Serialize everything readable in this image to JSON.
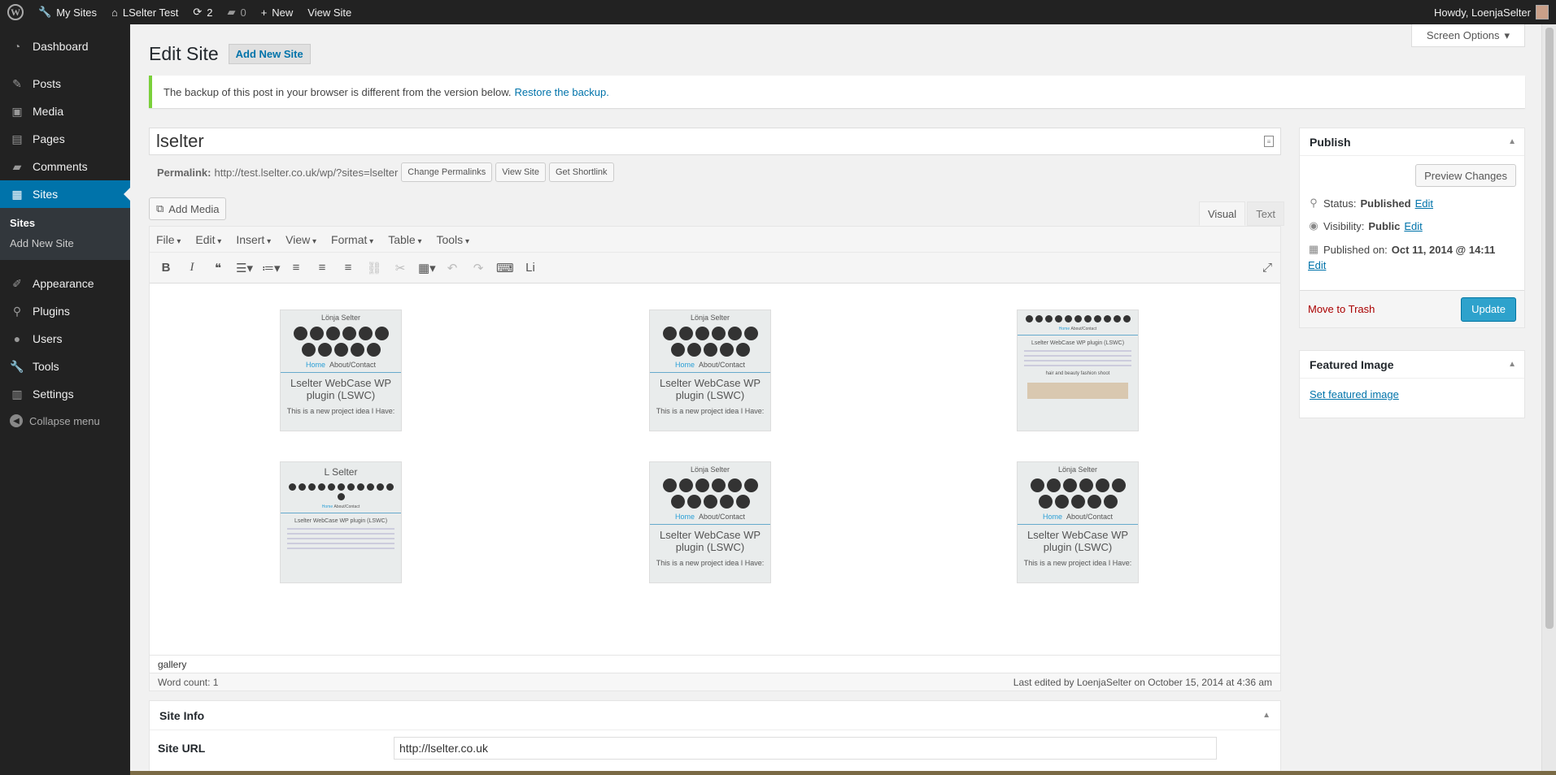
{
  "adminbar": {
    "my_sites": "My Sites",
    "site_name": "LSelter Test",
    "updates_count": "2",
    "comments_count": "0",
    "new_label": "New",
    "view_site": "View Site",
    "howdy": "Howdy, LoenjaSelter"
  },
  "sidebar": {
    "dashboard": "Dashboard",
    "posts": "Posts",
    "media": "Media",
    "pages": "Pages",
    "comments": "Comments",
    "sites": "Sites",
    "sub_sites": "Sites",
    "sub_add_new": "Add New Site",
    "appearance": "Appearance",
    "plugins": "Plugins",
    "users": "Users",
    "tools": "Tools",
    "settings": "Settings",
    "collapse": "Collapse menu"
  },
  "screen_options": "Screen Options",
  "page": {
    "title": "Edit Site",
    "add_new": "Add New Site"
  },
  "notice": {
    "text": "The backup of this post in your browser is different from the version below.",
    "link": "Restore the backup."
  },
  "post": {
    "title": "lselter",
    "permalink_label": "Permalink:",
    "permalink_url": "http://test.lselter.co.uk/wp/?sites=lselter",
    "change_permalinks": "Change Permalinks",
    "view_site": "View Site",
    "get_shortlink": "Get Shortlink"
  },
  "editor": {
    "add_media": "Add Media",
    "tab_visual": "Visual",
    "tab_text": "Text",
    "menus": [
      "File",
      "Edit",
      "Insert",
      "View",
      "Format",
      "Table",
      "Tools"
    ],
    "path": "gallery",
    "word_count": "Word count: 1",
    "last_edited": "Last edited by LoenjaSelter on October 15, 2014 at 4:36 am"
  },
  "thumbnails": {
    "top_name": "Lönja Selter",
    "nav_home": "Home",
    "nav_about": "About/Contact",
    "title": "Lselter WebCase WP plugin (LSWC)",
    "text": "This is a new project idea I Have:",
    "alt_heading": "L Selter",
    "small_title": "Lselter WebCase WP plugin (LSWC)",
    "fashion_caption": "hair and beauty fashion shoot"
  },
  "siteinfo": {
    "heading": "Site Info",
    "url_label": "Site URL",
    "url_value": "http://lselter.co.uk"
  },
  "publish": {
    "heading": "Publish",
    "preview": "Preview Changes",
    "status_label": "Status:",
    "status_value": "Published",
    "visibility_label": "Visibility:",
    "visibility_value": "Public",
    "published_label": "Published on:",
    "published_value": "Oct 11, 2014 @ 14:11",
    "edit": "Edit",
    "trash": "Move to Trash",
    "update": "Update"
  },
  "featured": {
    "heading": "Featured Image",
    "link": "Set featured image"
  },
  "colors": {
    "accent": "#0073aa",
    "primary_button": "#2ea2cc",
    "notice_border": "#7ad03a",
    "admin_bar": "#222222"
  }
}
